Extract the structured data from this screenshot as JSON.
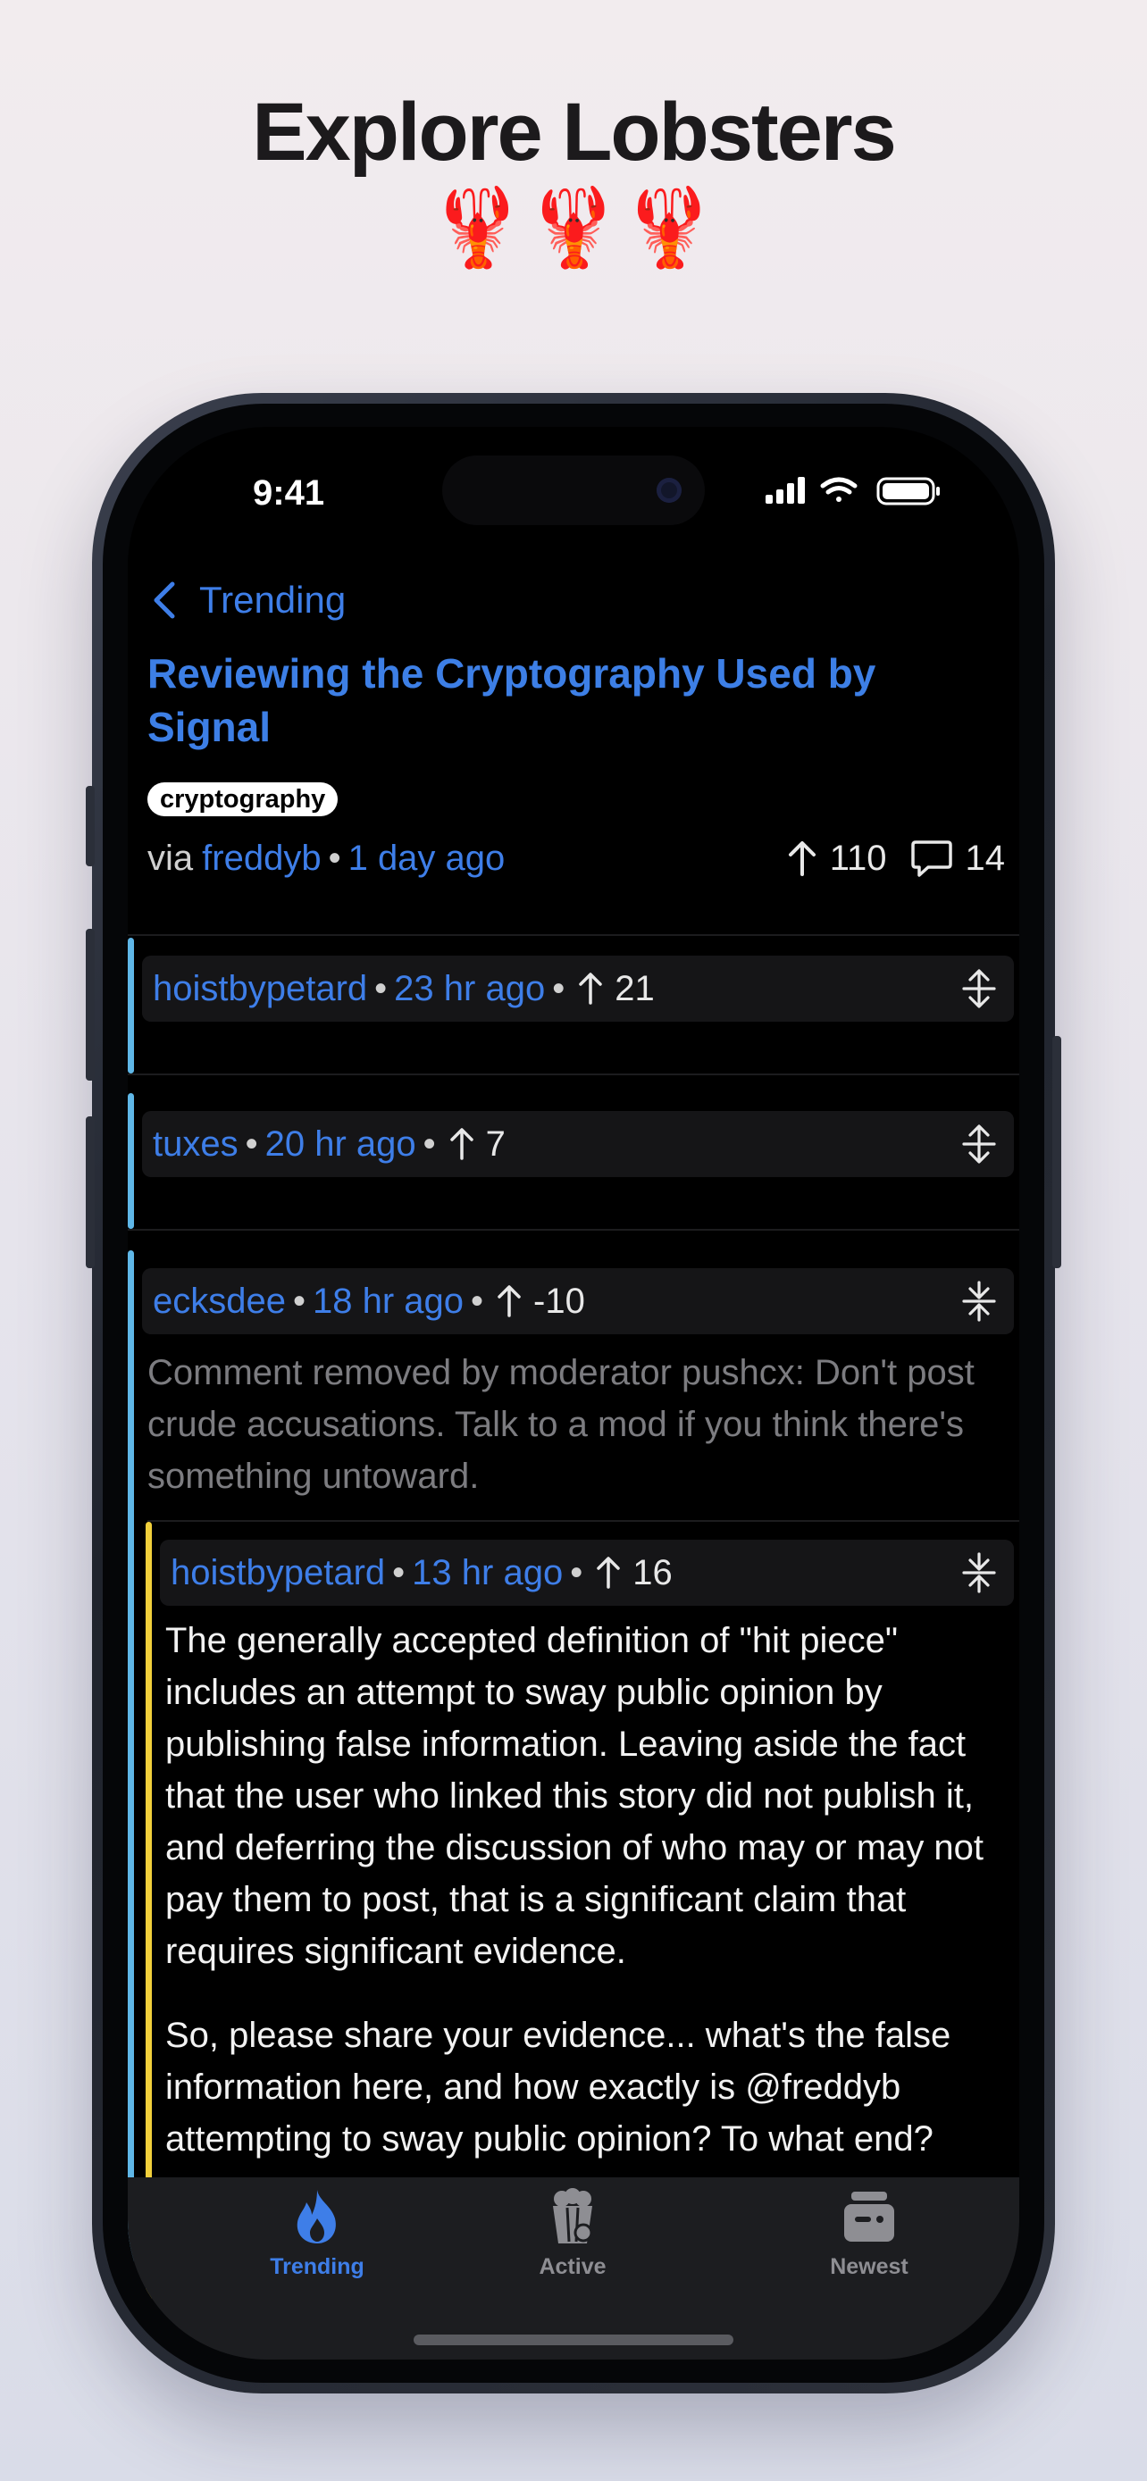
{
  "promo": {
    "title": "Explore Lobsters",
    "emoji": "🦞🦞🦞"
  },
  "status_bar": {
    "time": "9:41"
  },
  "nav": {
    "back_label": "Trending"
  },
  "story": {
    "title": "Reviewing the Cryptography Used by Signal",
    "tag": "cryptography",
    "via": "via",
    "author": "freddyb",
    "age": "1 day ago",
    "score": "110",
    "comment_count": "14"
  },
  "comments": [
    {
      "author": "hoistbypetard",
      "age": "23 hr ago",
      "score": "21",
      "collapsed": true,
      "bar_color": "#5fb7e8"
    },
    {
      "author": "tuxes",
      "age": "20 hr ago",
      "score": "7",
      "collapsed": true,
      "bar_color": "#5fb7e8"
    },
    {
      "author": "ecksdee",
      "age": "18 hr ago",
      "score": "-10",
      "collapsed": false,
      "bar_color": "#5fb7e8",
      "body": "Comment removed by moderator pushcx: Don't post crude accusations. Talk to a mod if you think there's something untoward."
    },
    {
      "author": "hoistbypetard",
      "age": "13 hr ago",
      "score": "16",
      "collapsed": false,
      "bar_color": "#f2d03c",
      "paragraphs": [
        "The generally accepted definition of \"hit piece\" includes an attempt to sway public opinion by publishing false information. Leaving aside the fact that the user who linked this story did not publish it, and deferring the discussion of who may or may not pay them to post, that is a significant claim that requires significant evidence.",
        "So, please share your evidence... what's the false information here, and how exactly is @freddyb attempting to sway public opinion? To what end?"
      ]
    }
  ],
  "tabbar": {
    "items": [
      {
        "label": "Trending",
        "icon": "flame-icon",
        "active": true
      },
      {
        "label": "Active",
        "icon": "popcorn-icon",
        "active": false
      },
      {
        "label": "Newest",
        "icon": "tray-icon",
        "active": false
      }
    ]
  },
  "colors": {
    "accent": "#3e7ee8",
    "thread_bar_1": "#5fb7e8",
    "thread_bar_2": "#f2d03c",
    "tab_inactive": "#8e8e93"
  }
}
